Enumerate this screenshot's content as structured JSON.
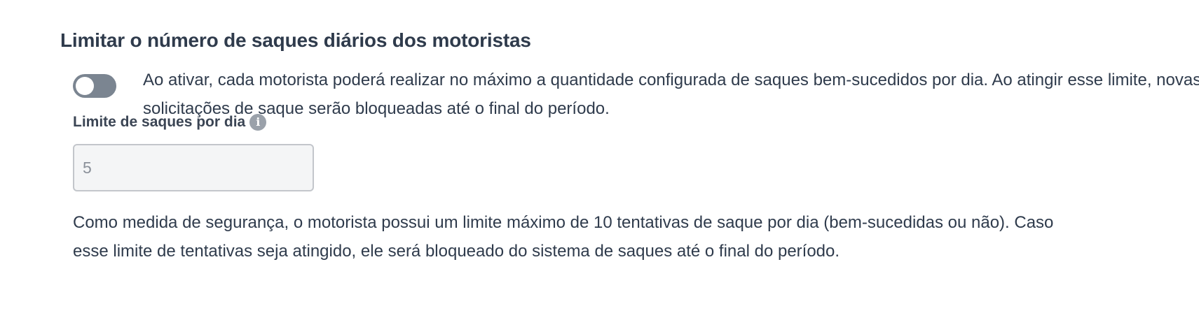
{
  "section": {
    "title": "Limitar o número de saques diários dos motoristas",
    "toggle": {
      "state": "off",
      "description": "Ao ativar, cada motorista poderá realizar no máximo a quantidade configurada de saques bem-sucedidos por dia. Ao atingir esse limite, novas solicitações de saque serão bloqueadas até o final do período."
    },
    "limit_field": {
      "label": "Limite de saques por dia",
      "info_icon": "info-icon",
      "value": "5",
      "disabled": true
    },
    "security_note": "Como medida de segurança, o motorista possui um limite máximo de 10 tentativas de saque por dia (bem-sucedidas ou não). Caso esse limite de tentativas seja atingido, ele será bloqueado do sistema de saques até o final do período."
  },
  "colors": {
    "text": "#2f3b4c",
    "toggle_off": "#7b8591",
    "input_bg": "#f4f5f6",
    "input_border": "#c3c6cb",
    "info_icon": "#9aa1aa"
  }
}
